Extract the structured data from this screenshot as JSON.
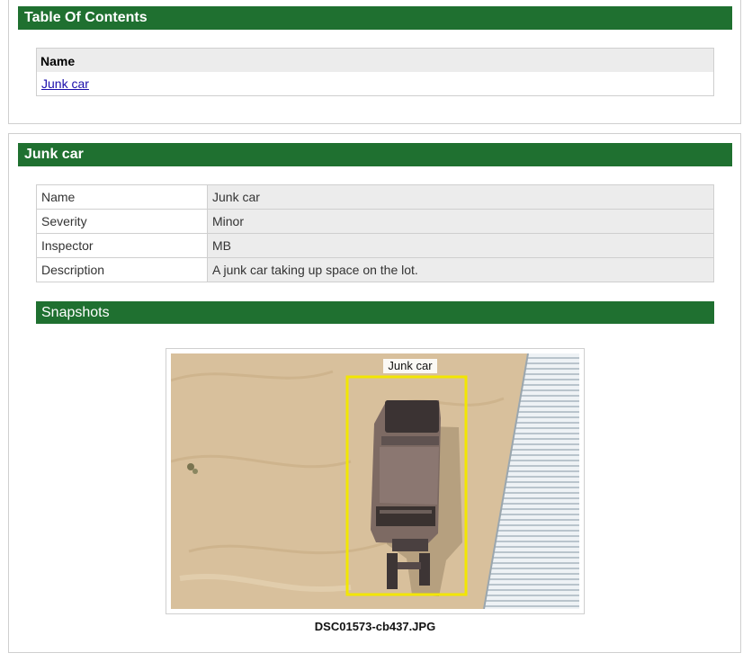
{
  "toc": {
    "title": "Table Of Contents",
    "column_header": "Name",
    "items": [
      {
        "label": "Junk car"
      }
    ]
  },
  "issue": {
    "title": "Junk car",
    "rows": [
      {
        "key": "Name",
        "value": "Junk car"
      },
      {
        "key": "Severity",
        "value": "Minor"
      },
      {
        "key": "Inspector",
        "value": "MB"
      },
      {
        "key": "Description",
        "value": "A junk car taking up space on the lot."
      }
    ],
    "snapshots_title": "Snapshots",
    "snapshot": {
      "annotation_label": "Junk car",
      "annotation_color": "#f2e600",
      "filename": "DSC01573-cb437.JPG"
    }
  },
  "colors": {
    "header_green": "#1f7030",
    "link": "#1a0dab"
  }
}
